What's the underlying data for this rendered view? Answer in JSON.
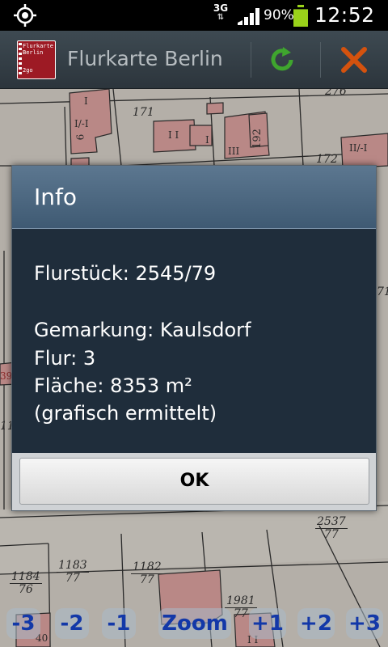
{
  "status_bar": {
    "network_type": "3G",
    "battery_percent": "90%",
    "battery_level": 0.9,
    "time": "12:52",
    "icons": [
      "gps-icon",
      "network-activity-icon",
      "signal-icon",
      "battery-icon"
    ]
  },
  "action_bar": {
    "app_logo_lines": [
      "Flurkarte",
      "Berlin",
      "2go"
    ],
    "title": "Flurkarte Berlin",
    "icons": [
      "app-logo-icon",
      "refresh-icon",
      "close-icon"
    ],
    "colors": {
      "refresh": "#3fa52e",
      "close": "#d4520e"
    }
  },
  "map": {
    "parcel_labels": [
      {
        "text": "276"
      },
      {
        "text": "171"
      },
      {
        "text": "172"
      },
      {
        "text": "II/-I"
      },
      {
        "text": "I"
      },
      {
        "text": "I/-I"
      },
      {
        "text": "6"
      },
      {
        "text": "192"
      },
      {
        "text": "III"
      },
      {
        "text": "I I"
      },
      {
        "text": "I"
      },
      {
        "text": "39"
      },
      {
        "text": "11"
      },
      {
        "text": "71"
      },
      {
        "text": "40"
      },
      {
        "text": "I I"
      }
    ],
    "fraction_labels": [
      {
        "num": "2537",
        "den": "77"
      },
      {
        "num": "1183",
        "den": "77"
      },
      {
        "num": "1182",
        "den": "77"
      },
      {
        "num": "1184",
        "den": "76"
      },
      {
        "num": "1981",
        "den": "77"
      }
    ]
  },
  "zoom_bar": {
    "buttons": [
      "-3",
      "-2",
      "-1",
      "Zoom",
      "+1",
      "+2",
      "+3"
    ]
  },
  "dialog": {
    "title": "Info",
    "flurstueck": "Flurstück: 2545/79",
    "gemarkung": "Gemarkung: Kaulsdorf",
    "flur": "Flur: 3",
    "flaeche": "Fläche: 8353 m²",
    "note": "(grafisch ermittelt)",
    "ok_label": "OK"
  }
}
